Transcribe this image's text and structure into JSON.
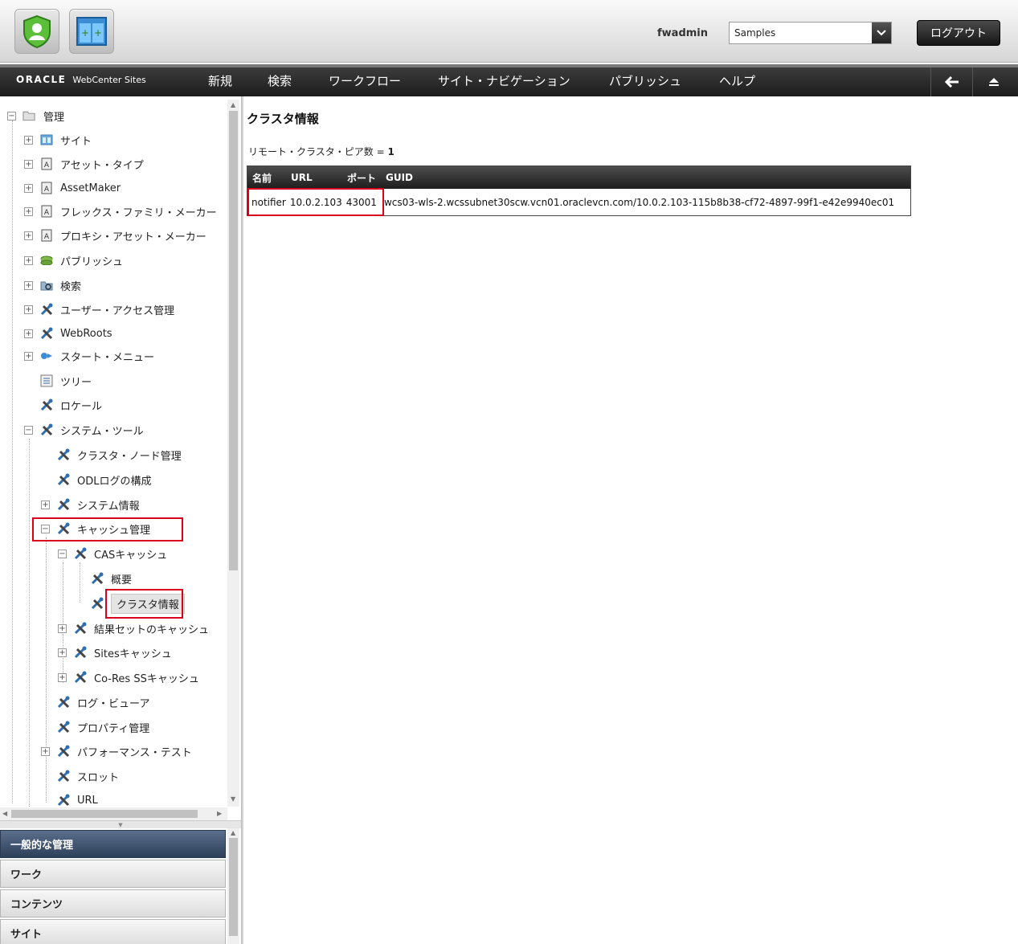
{
  "header": {
    "username": "fwadmin",
    "site_selector": {
      "selected": "Samples"
    },
    "logout_label": "ログアウト"
  },
  "navbar": {
    "brand_oracle": "ORACLE",
    "brand_product": "WebCenter Sites",
    "items": [
      "新規",
      "検索",
      "ワークフロー",
      "サイト・ナビゲーション",
      "パブリッシュ",
      "ヘルプ"
    ]
  },
  "tree": {
    "root": "管理",
    "items": [
      "サイト",
      "アセット・タイプ",
      "AssetMaker",
      "フレックス・ファミリ・メーカー",
      "プロキシ・アセット・メーカー",
      "パブリッシュ",
      "検索",
      "ユーザー・アクセス管理",
      "WebRoots",
      "スタート・メニュー",
      "ツリー",
      "ロケール",
      "システム・ツール"
    ],
    "system_tools": [
      "クラスタ・ノード管理",
      "ODLログの構成",
      "システム情報",
      "キャッシュ管理"
    ],
    "cache_management": [
      "CASキャッシュ"
    ],
    "cas_cache": [
      "概要",
      "クラスタ情報"
    ],
    "cache_more": [
      "結果セットのキャッシュ",
      "Sitesキャッシュ",
      "Co-Res SSキャッシュ"
    ],
    "system_tools_more": [
      "ログ・ビューア",
      "プロパティ管理",
      "パフォーマンス・テスト",
      "スロット",
      "URL"
    ]
  },
  "accordion": [
    "一般的な管理",
    "ワーク",
    "コンテンツ",
    "サイト"
  ],
  "main": {
    "title": "クラスタ情報",
    "peer_label": "リモート・クラスタ・ピア数 =",
    "peer_count": "1",
    "table": {
      "headers": [
        "名前",
        "URL",
        "ポート",
        "GUID"
      ],
      "rows": [
        {
          "name": "notifier",
          "url": "10.0.2.103",
          "port": "43001",
          "guid": "wcs03-wls-2.wcssubnet30scw.vcn01.oraclevcn.com/10.0.2.103-115b8b38-cf72-4897-99f1-e42e9940ec01"
        }
      ]
    }
  },
  "colors": {
    "highlight_red": "#d9001b",
    "nav_dark": "#1c1c1c",
    "accordion_active": "#2e405a"
  }
}
